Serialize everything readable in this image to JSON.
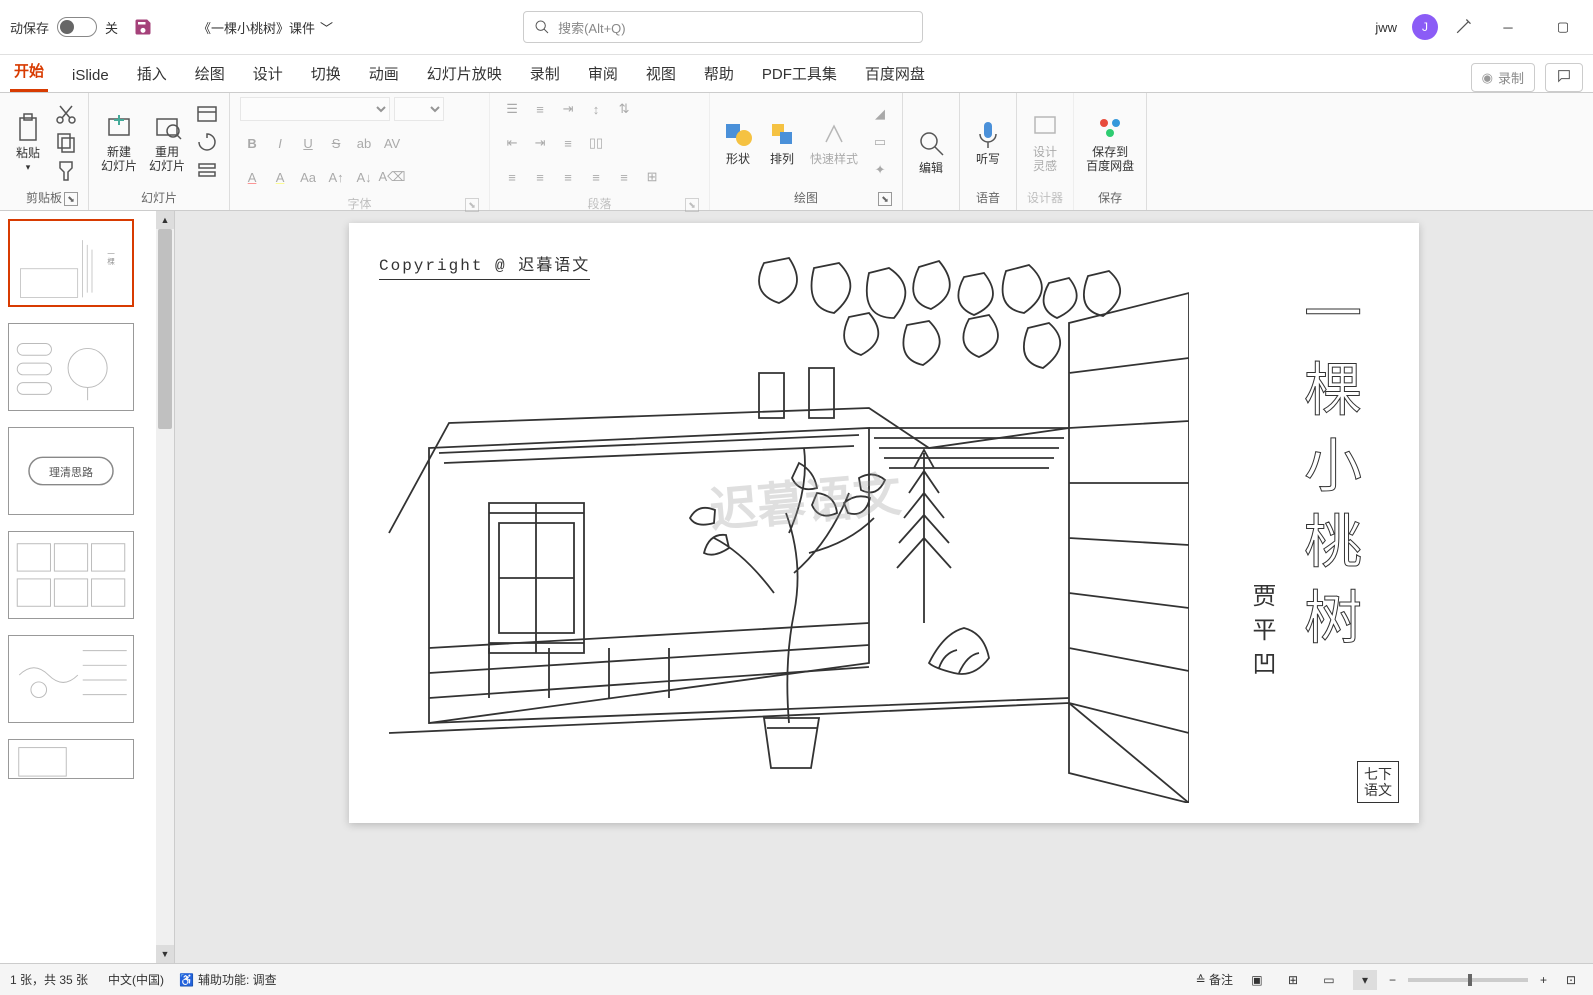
{
  "titlebar": {
    "autosave_label": "动保存",
    "autosave_state": "关",
    "document_title": "《一棵小桃树》课件",
    "search_placeholder": "搜索(Alt+Q)",
    "username": "jww",
    "avatar_initial": "J"
  },
  "tabs": {
    "items": [
      "开始",
      "iSlide",
      "插入",
      "绘图",
      "设计",
      "切换",
      "动画",
      "幻灯片放映",
      "录制",
      "审阅",
      "视图",
      "帮助",
      "PDF工具集",
      "百度网盘"
    ],
    "active_index": 0,
    "record_label": "录制"
  },
  "ribbon": {
    "clipboard": {
      "label": "剪贴板",
      "paste": "粘贴"
    },
    "slides": {
      "label": "幻灯片",
      "new": "新建\n幻灯片",
      "reuse": "重用\n幻灯片"
    },
    "font": {
      "label": "字体"
    },
    "paragraph": {
      "label": "段落"
    },
    "drawing": {
      "label": "绘图",
      "shapes": "形状",
      "arrange": "排列",
      "quick_style": "快速样式"
    },
    "editing": {
      "label": "编辑"
    },
    "voice": {
      "label": "语音",
      "dictate": "听写"
    },
    "designer": {
      "label": "设计器",
      "ideas": "设计\n灵感"
    },
    "save": {
      "label": "保存",
      "baidu": "保存到\n百度网盘"
    }
  },
  "slide_content": {
    "copyright": "Copyright   @   迟暮语文",
    "title": "一棵小桃树",
    "author": "贾平凹",
    "grade_line1": "七下",
    "grade_line2": "语文",
    "watermark": "迟暮语文"
  },
  "thumbnails": {
    "slide3_text": "理清思路"
  },
  "statusbar": {
    "slide_count": "1 张，共 35 张",
    "language": "中文(中国)",
    "accessibility": "辅助功能: 调查",
    "notes": "备注"
  }
}
